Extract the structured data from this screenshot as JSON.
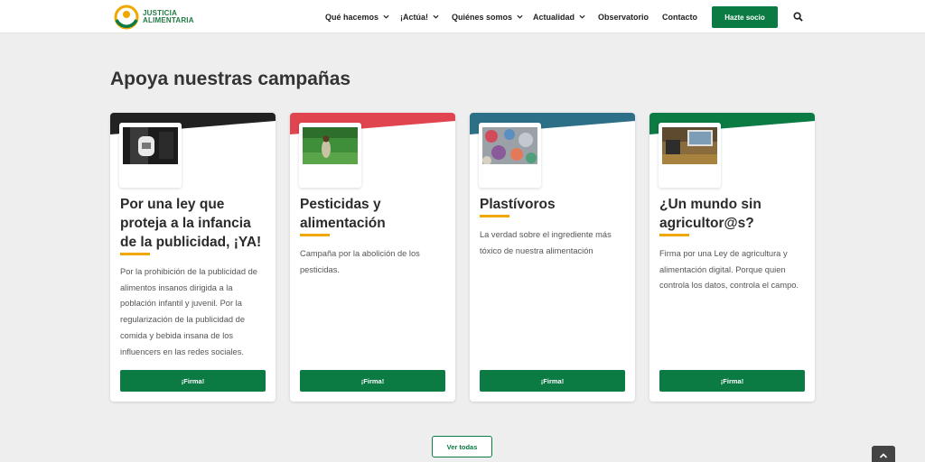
{
  "header": {
    "logo": {
      "line1": "JUSTICIA",
      "line2": "ALIMENTARIA"
    },
    "nav": [
      {
        "label": "Qué hacemos",
        "dropdown": true
      },
      {
        "label": "¡Actúa!",
        "dropdown": true
      },
      {
        "label": "Quiénes somos",
        "dropdown": true
      },
      {
        "label": "Actualidad",
        "dropdown": true
      },
      {
        "label": "Observatorio",
        "dropdown": false
      },
      {
        "label": "Contacto",
        "dropdown": false
      }
    ],
    "cta_label": "Hazte socio",
    "search_icon": "search-icon"
  },
  "section": {
    "title": "Apoya nuestras campañas"
  },
  "cards": [
    {
      "title": "Por una ley que proteja a la infancia de la publicidad, ¡YA!",
      "description": "Por la prohibición de la publicidad de alimentos insanos dirigida a la población infantil y juvenil. Por la regularización de la publicidad de comida y bebida insana de los influencers en las redes sociales.",
      "button": "¡Firma!",
      "accent": "#222222"
    },
    {
      "title": "Pesticidas y alimentación",
      "description": "Campaña por la abolición de los pesticidas.",
      "button": "¡Firma!",
      "accent": "#e0444e"
    },
    {
      "title": "Plastívoros",
      "description": "La verdad sobre el ingrediente más tóxico de nuestra alimentación",
      "button": "¡Firma!",
      "accent": "#2c6f86"
    },
    {
      "title": "¿Un mundo sin agricultor@s?",
      "description": "Firma por una Ley de agricultura y alimentación digital. Porque quien controla los datos, controla el campo.",
      "button": "¡Firma!",
      "accent": "#0b7a43"
    }
  ],
  "ver_todas": "Ver todas",
  "colors": {
    "primary": "#0b7a43",
    "highlight": "#f0a800",
    "background": "#eeeeee"
  }
}
